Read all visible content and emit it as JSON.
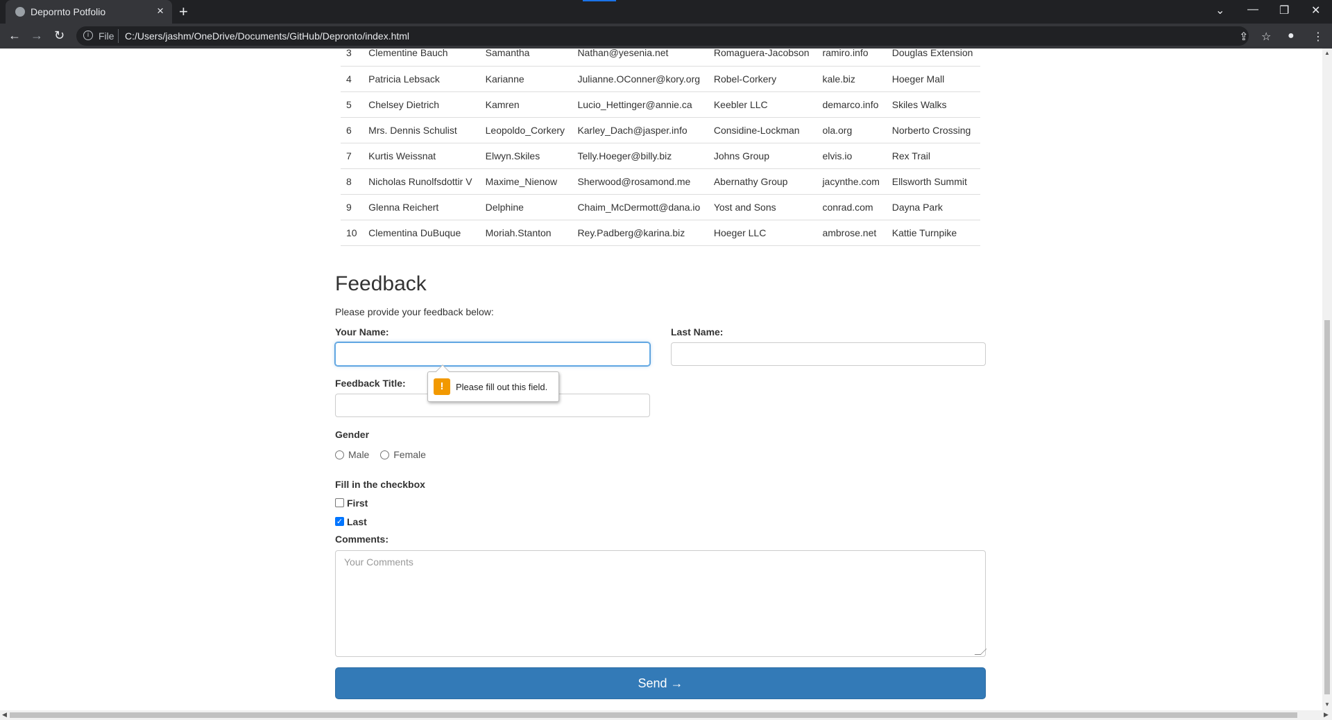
{
  "browser": {
    "tab_title": "Depornto Potfolio",
    "tab_close": "×",
    "new_tab": "+",
    "scheme": "File",
    "url": "C:/Users/jashm/OneDrive/Documents/GitHub/Depronto/index.html"
  },
  "table": {
    "rows": [
      [
        "3",
        "Clementine Bauch",
        "Samantha",
        "Nathan@yesenia.net",
        "Romaguera-Jacobson",
        "ramiro.info",
        "Douglas Extension"
      ],
      [
        "4",
        "Patricia Lebsack",
        "Karianne",
        "Julianne.OConner@kory.org",
        "Robel-Corkery",
        "kale.biz",
        "Hoeger Mall"
      ],
      [
        "5",
        "Chelsey Dietrich",
        "Kamren",
        "Lucio_Hettinger@annie.ca",
        "Keebler LLC",
        "demarco.info",
        "Skiles Walks"
      ],
      [
        "6",
        "Mrs. Dennis Schulist",
        "Leopoldo_Corkery",
        "Karley_Dach@jasper.info",
        "Considine-Lockman",
        "ola.org",
        "Norberto Crossing"
      ],
      [
        "7",
        "Kurtis Weissnat",
        "Elwyn.Skiles",
        "Telly.Hoeger@billy.biz",
        "Johns Group",
        "elvis.io",
        "Rex Trail"
      ],
      [
        "8",
        "Nicholas Runolfsdottir V",
        "Maxime_Nienow",
        "Sherwood@rosamond.me",
        "Abernathy Group",
        "jacynthe.com",
        "Ellsworth Summit"
      ],
      [
        "9",
        "Glenna Reichert",
        "Delphine",
        "Chaim_McDermott@dana.io",
        "Yost and Sons",
        "conrad.com",
        "Dayna Park"
      ],
      [
        "10",
        "Clementina DuBuque",
        "Moriah.Stanton",
        "Rey.Padberg@karina.biz",
        "Hoeger LLC",
        "ambrose.net",
        "Kattie Turnpike"
      ]
    ]
  },
  "feedback": {
    "heading": "Feedback",
    "intro": "Please provide your feedback below:",
    "your_name_label": "Your Name:",
    "last_name_label": "Last Name:",
    "title_label": "Feedback Title:",
    "gender_label": "Gender",
    "gender_options": [
      "Male",
      "Female"
    ],
    "checkbox_heading": "Fill in the checkbox",
    "checkboxes": [
      {
        "label": "First",
        "checked": false
      },
      {
        "label": "Last",
        "checked": true
      }
    ],
    "comments_label": "Comments:",
    "comments_placeholder": "Your Comments",
    "send_label": "Send →",
    "validation_message": "Please fill out this field."
  },
  "colors": {
    "primary_button": "#337ab7",
    "warning_icon": "#f29900",
    "checkbox_checked": "#0075ff"
  }
}
